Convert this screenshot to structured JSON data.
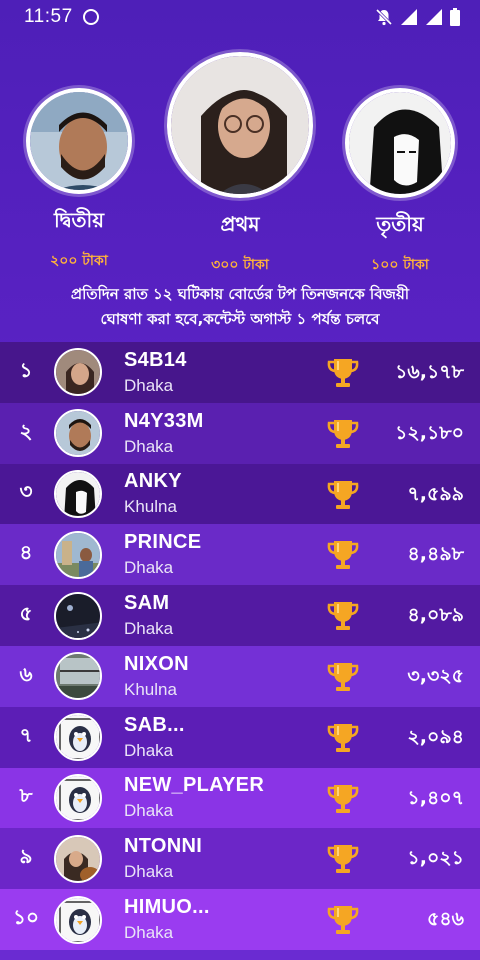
{
  "status": {
    "time": "11:57"
  },
  "podium": {
    "second": {
      "title": "দ্বিতীয়",
      "prize": "২০০ টাকা"
    },
    "first": {
      "title": "প্রথম",
      "prize": "৩০০ টাকা"
    },
    "third": {
      "title": "তৃতীয়",
      "prize": "১০০ টাকা"
    }
  },
  "notice": {
    "line1": "প্রতিদিন রাত ১২ ঘটিকায় বোর্ডের টপ তিনজনকে বিজয়ী",
    "line2": "ঘোষণা করা হবে,কন্টেস্ট অগাস্ট ১ পর্যন্ত চলবে"
  },
  "leaderboard": [
    {
      "rank": "১",
      "name": "S4B14",
      "city": "Dhaka",
      "score": "১৬,১৭৮",
      "avatar": "woman"
    },
    {
      "rank": "২",
      "name": "N4Y33M",
      "city": "Dhaka",
      "score": "১২,১৮০",
      "avatar": "man"
    },
    {
      "rank": "৩",
      "name": "ANKY",
      "city": "Khulna",
      "score": "৭,৫৯৯",
      "avatar": "sketch"
    },
    {
      "rank": "৪",
      "name": "PRINCE",
      "city": "Dhaka",
      "score": "৪,৪৯৮",
      "avatar": "outdoor"
    },
    {
      "rank": "৫",
      "name": "SAM",
      "city": "Dhaka",
      "score": "৪,০৮৯",
      "avatar": "night"
    },
    {
      "rank": "৬",
      "name": "NIXON",
      "city": "Khulna",
      "score": "৩,৩২৫",
      "avatar": "window"
    },
    {
      "rank": "৭",
      "name": "SAB...",
      "city": "Dhaka",
      "score": "২,০৯৪",
      "avatar": "penguin"
    },
    {
      "rank": "৮",
      "name": "NEW_PLAYER",
      "city": "Dhaka",
      "score": "১,৪০৭",
      "avatar": "penguin"
    },
    {
      "rank": "৯",
      "name": "NTONNI",
      "city": "Dhaka",
      "score": "১,০২১",
      "avatar": "guitar"
    },
    {
      "rank": "১০",
      "name": "HIMUO...",
      "city": "Dhaka",
      "score": "৫৪৬",
      "avatar": "penguin"
    }
  ],
  "colors": {
    "accent_prize": "#ffb33a",
    "trophy": "#f5a623"
  }
}
